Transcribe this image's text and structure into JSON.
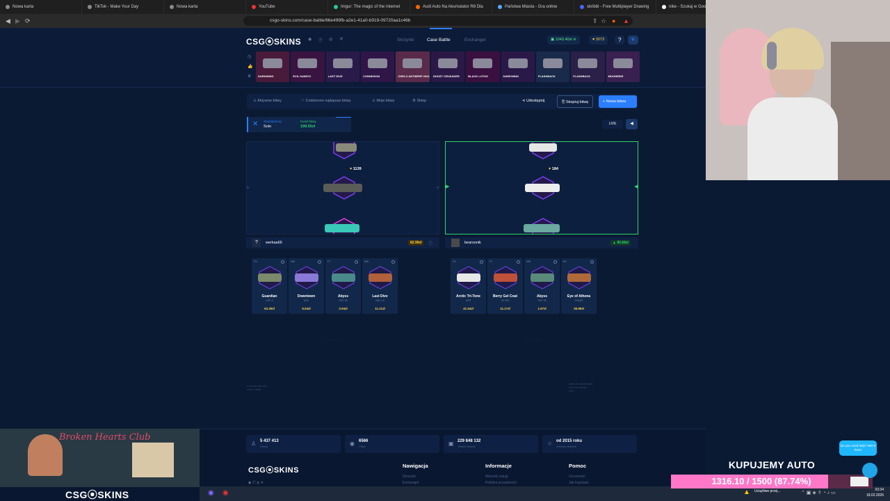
{
  "browser": {
    "tabs": [
      "Nowa karta",
      "TikTok - Make Your Day",
      "Nowa karta",
      "YouTube",
      "Imgur: The magic of the Internet",
      "Audi Auto Na Akumulator R8 Dla",
      "Państwa Miasta - Gra online",
      "skribbl - Free Multiplayer Drawing",
      "nike - Szukaj w Google"
    ],
    "url": "csgo-skins.com/case-battle/66e499fb-a2e1-41a0-b919-09720aa1c46b"
  },
  "header": {
    "logo": "CSG⦿SKINS",
    "menu": [
      "Skrzynki",
      "Case Battle",
      "Exchanger"
    ],
    "balance": "1043.40zł",
    "coins": "3073",
    "help": "?"
  },
  "cases": [
    {
      "name": "DARKWING",
      "color": "#4a1a3a"
    },
    {
      "name": "EVIL DAIMYO",
      "color": "#3a1440"
    },
    {
      "name": "LAST DIVE",
      "color": "#2a1a4a"
    },
    {
      "name": "CONNEXION",
      "color": "#301548"
    },
    {
      "name": "CHELO ANTWERP 2022",
      "color": "#5a2a4a"
    },
    {
      "name": "GHOST CRUSADER",
      "color": "#2c1846"
    },
    {
      "name": "BLACK LOTUS",
      "color": "#3a1040"
    },
    {
      "name": "DARKWING",
      "color": "#2a1848"
    },
    {
      "name": "FLASHBACK",
      "color": "#1a2a4a"
    },
    {
      "name": "FLASHBACK",
      "color": "#2a2048"
    },
    {
      "name": "MOONRISE",
      "color": "#3a2050"
    }
  ],
  "toolbar": {
    "active": "Aktywne bitwy",
    "best": "Codzienne najlepsze bitwy",
    "mine": "Moje bitwy",
    "shop": "Sklep",
    "share": "Udostępnij",
    "copy": "Skopiuj bitwę",
    "new": "+ Nowa bitwa"
  },
  "mode": {
    "label": "Standardowy",
    "value": "Solo",
    "cost_label": "Koszt bitwy",
    "cost": "199.50zł",
    "live": "LIVE"
  },
  "players": [
    {
      "name": "werkaa65",
      "total": "82.99zł",
      "coins": "1139",
      "items": [
        {
          "cond": "FN",
          "name": "Guardian",
          "sub": "USP-S",
          "price": "63.39zł",
          "color": "#7b8a6a"
        },
        {
          "cond": "MW",
          "name": "Downtown",
          "sub": "MP9",
          "price": "5.54zł",
          "color": "#8a7ad8"
        },
        {
          "cond": "FT",
          "name": "Abyss",
          "sub": "SSG 08",
          "price": "2.94zł",
          "color": "#4a8a8a"
        },
        {
          "cond": "MW",
          "name": "Last Dive",
          "sub": "MAC-10",
          "price": "11.21zł",
          "color": "#b0603a"
        }
      ]
    },
    {
      "name": "bearsonik",
      "total": "90.68zł",
      "coins": "184",
      "items": [
        {
          "cond": "FN",
          "name": "Arctic Tri-Tone",
          "sub": "MP9",
          "price": "41.54zł",
          "color": "#e8e8e8"
        },
        {
          "cond": "FT",
          "name": "Berry Gel Coat",
          "sub": "SG 553",
          "price": "11.17zł",
          "color": "#c0503a"
        },
        {
          "cond": "MW",
          "name": "Abyss",
          "sub": "SSG 08",
          "price": "1.97zł",
          "color": "#5a8a7a"
        },
        {
          "cond": "BS",
          "name": "Eye of Athena",
          "sub": "FAMAS",
          "price": "35.99zł",
          "color": "#b06a3a"
        }
      ]
    }
  ],
  "footer": {
    "stats": [
      {
        "value": "5 437 413",
        "label": "Graczy",
        "icon": "users-icon"
      },
      {
        "value": "6566",
        "label": "Online",
        "icon": "online-icon"
      },
      {
        "value": "229 848 132",
        "label": "Otwarte skrzynki",
        "icon": "box-icon"
      },
      {
        "value": "od 2015 roku",
        "label": "w branży skrzynek",
        "icon": "star-icon"
      }
    ],
    "logo": "CSG⦿SKINS",
    "cols": [
      {
        "title": "Nawigacja",
        "links": [
          "Skrzynki",
          "Exchanger"
        ]
      },
      {
        "title": "Informacje",
        "links": [
          "Warunki usługi",
          "Polityka prywatności"
        ]
      },
      {
        "title": "Pomoc",
        "links": [
          "Uczciwość",
          "Jak kupować"
        ]
      }
    ]
  },
  "stream": {
    "goal_title": "KUPUJEMY AUTO",
    "goal_text": "1316.10 / 1500 (87.74%)",
    "goal_fraction": 0.8774,
    "game_title": "Broken Hearts Club",
    "game_logo": "CSG⦿SKINS",
    "help_text": "Do you need help? We're here!"
  },
  "taskbar": {
    "time": "03:34",
    "date": "18.02.2026",
    "weather": "Uciążliwe przej..."
  }
}
